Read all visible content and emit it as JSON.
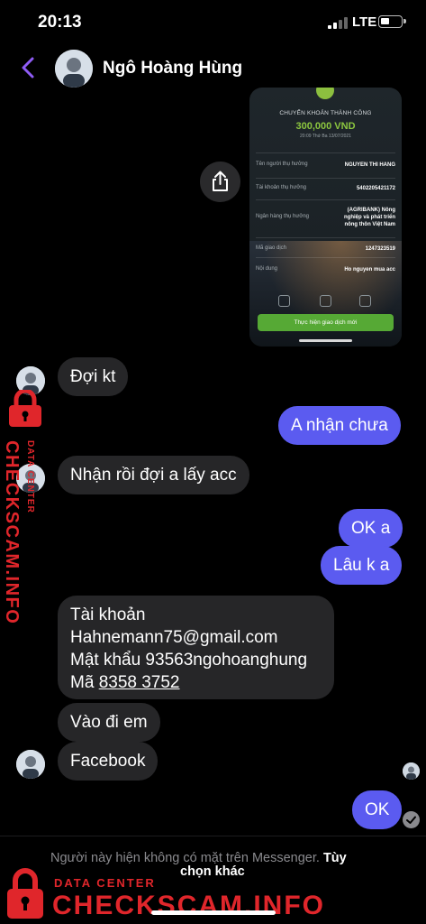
{
  "status_bar": {
    "time": "20:13",
    "network": "LTE"
  },
  "header": {
    "contact_name": "Ngô Hoàng Hùng"
  },
  "receipt": {
    "title": "CHUYỂN KHOẢN THÀNH CÔNG",
    "amount": "300,000 VND",
    "datetime": "20:09 Thứ Ba 13/07/2021",
    "rows": [
      {
        "label": "Tên người thụ hưởng",
        "value": "NGUYEN THI HANG"
      },
      {
        "label": "Tài khoản thụ hưởng",
        "value": "5402205421172"
      },
      {
        "label": "Ngân hàng thụ hưởng",
        "value_lines": [
          "(AGRIBANK) Nông",
          "nghiệp và phát triển",
          "nông thôn Việt Nam"
        ]
      },
      {
        "label": "Mã giao dịch",
        "value": "1247323519"
      },
      {
        "label": "Nội dung",
        "value": "Ho nguyen mua acc"
      }
    ],
    "button": "Thực hiện giao dịch mới"
  },
  "messages": [
    {
      "from": "them",
      "text": "Đợi kt"
    },
    {
      "from": "me",
      "text": "A nhận chưa"
    },
    {
      "from": "them",
      "text": "Nhận rồi đợi a lấy acc"
    },
    {
      "from": "me",
      "text": "OK a"
    },
    {
      "from": "me",
      "text": "Lâu k a"
    },
    {
      "from": "them",
      "lines": [
        "Tài khoản",
        "Hahnemann75@gmail.com",
        "Mật khẩu 93563ngohoanghung",
        "Mã "
      ],
      "code": "8358 3752"
    },
    {
      "from": "them",
      "text": "Vào đi em"
    },
    {
      "from": "them",
      "text": "Facebook"
    },
    {
      "from": "me",
      "text": "OK"
    }
  ],
  "footer": {
    "notice": "Người này hiện không có mặt trên Messenger.",
    "link_part1": "Tùy",
    "link_part2": "chọn khác"
  },
  "watermark": {
    "small": "DATA CENTER",
    "big": "CHECKSCAM.INFO",
    "color": "#e0262b"
  },
  "colors": {
    "outgoing_bubble": "#5b5bf0",
    "incoming_bubble": "#262628",
    "accent_back": "#8f5cf5"
  }
}
